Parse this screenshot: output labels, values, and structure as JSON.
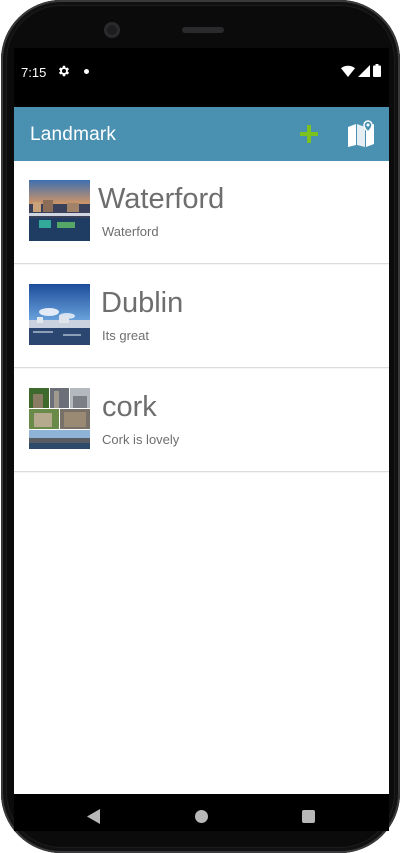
{
  "status_bar": {
    "time": "7:15",
    "icons": [
      "settings-icon",
      "notification-dot-icon",
      "wifi-icon",
      "signal-icon",
      "battery-icon"
    ]
  },
  "toolbar": {
    "title": "Landmark",
    "color": "#4a90b0",
    "actions": [
      {
        "icon": "add-icon",
        "color": "#7cc21f"
      },
      {
        "icon": "map-icon",
        "color": "#ffffff"
      }
    ]
  },
  "landmarks": [
    {
      "title": "Waterford",
      "description": "Waterford",
      "image": "waterford-photo"
    },
    {
      "title": "Dublin",
      "description": "Its great",
      "image": "dublin-photo"
    },
    {
      "title": "cork",
      "description": "Cork is lovely",
      "image": "cork-collage-photo"
    }
  ],
  "nav_bar": {
    "buttons": [
      "back-icon",
      "home-icon",
      "recents-icon"
    ]
  }
}
